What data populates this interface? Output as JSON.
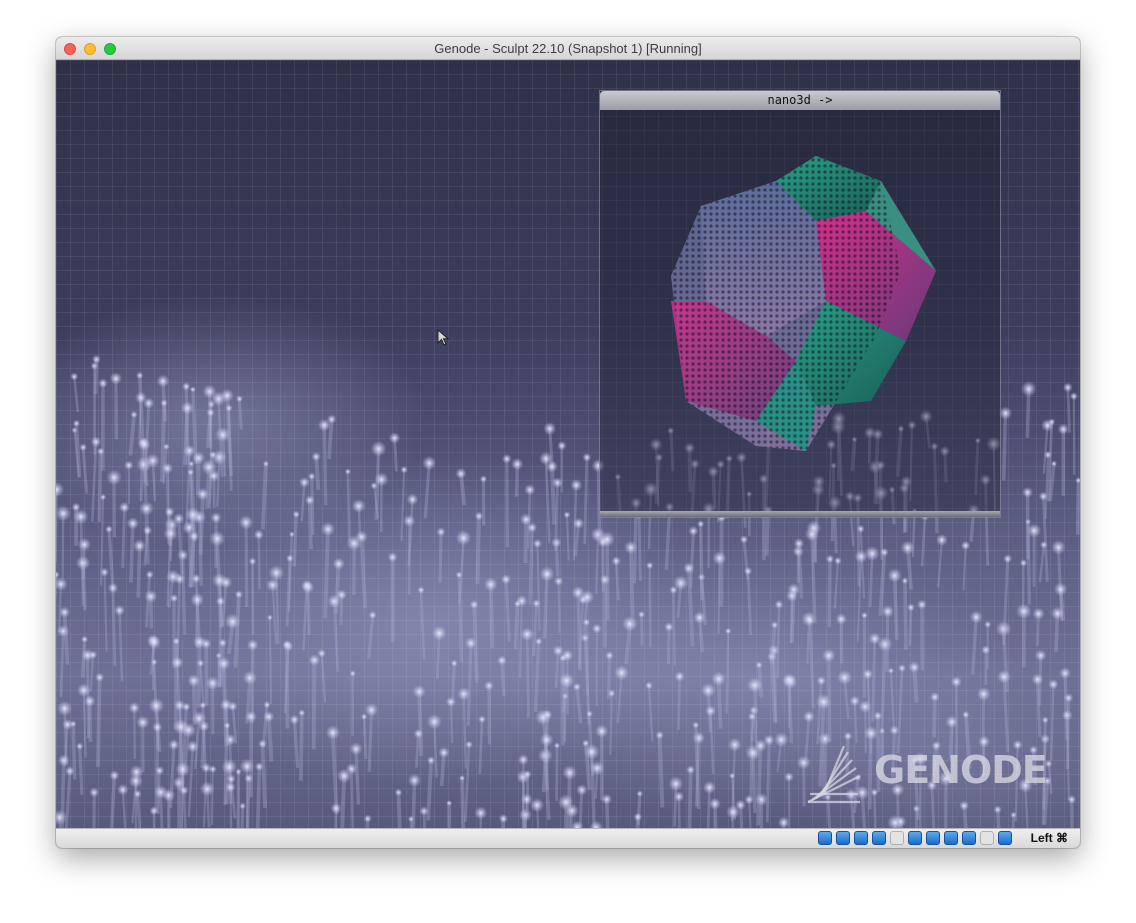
{
  "window": {
    "title": "Genode - Sculpt 22.10 (Snapshot 1) [Running]"
  },
  "nano3d": {
    "title": "nano3d ->"
  },
  "logo": {
    "text": "GENODE"
  },
  "statusbar": {
    "host_key": "Left ⌘",
    "icons": [
      "hard-disk-icon",
      "optical-drive-icon",
      "network-icon",
      "usb-icon",
      "shared-folder-icon",
      "display-icon",
      "video-capture-icon",
      "capture-icon",
      "mouse-integration-icon",
      "cpu-icon",
      "host-key-arrow-icon"
    ]
  },
  "colors": {
    "desktop_dark": "#2f3048",
    "desktop_light": "#6e7096",
    "close": "#fc5f57",
    "minimize": "#fdbc2e",
    "zoom": "#28c840",
    "teal": "#1e8a78",
    "magenta": "#c0287a"
  }
}
